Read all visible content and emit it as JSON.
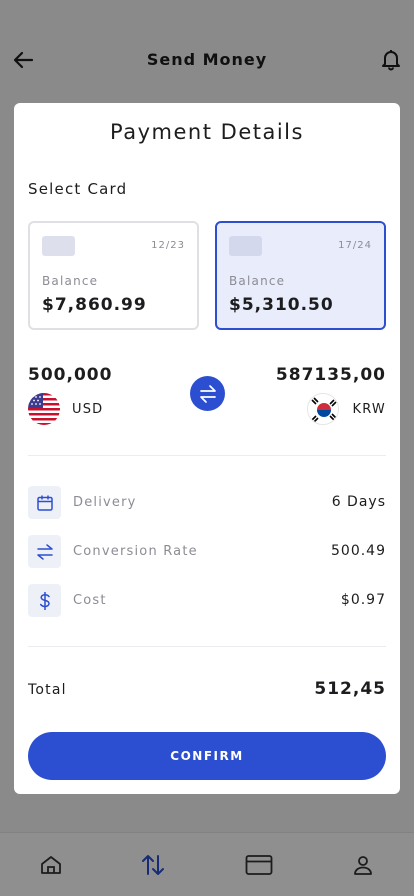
{
  "header": {
    "title": "Send Money",
    "back_icon": "arrow-left-icon",
    "notification_icon": "bell-icon"
  },
  "modal": {
    "title": "Payment Details",
    "select_card_label": "Select Card",
    "cards": [
      {
        "expiry": "12/23",
        "balance_label": "Balance",
        "balance": "$7,860.99",
        "selected": false
      },
      {
        "expiry": "17/24",
        "balance_label": "Balance",
        "balance": "$5,310.50",
        "selected": true
      }
    ],
    "exchange": {
      "from_amount": "500,000",
      "from_currency": "USD",
      "to_amount": "587135,00",
      "to_currency": "KRW",
      "swap_icon": "swap-arrows-icon"
    },
    "details": [
      {
        "icon": "calendar-icon",
        "label": "Delivery",
        "value": "6 Days"
      },
      {
        "icon": "swap-arrows-icon",
        "label": "Conversion Rate",
        "value": "500.49"
      },
      {
        "icon": "dollar-icon",
        "label": "Cost",
        "value": "$0.97"
      }
    ],
    "total_label": "Total",
    "total_value": "512,45",
    "confirm_label": "CONFIRM"
  },
  "bottom_nav": {
    "items": [
      {
        "icon": "home-icon",
        "active": false
      },
      {
        "icon": "transfer-icon",
        "active": true
      },
      {
        "icon": "card-icon",
        "active": false
      },
      {
        "icon": "profile-icon",
        "active": false
      }
    ]
  },
  "colors": {
    "accent": "#2c4fd1",
    "selected_card_bg": "#e9ecfb",
    "overlay": "rgba(0,0,0,0.44)"
  }
}
